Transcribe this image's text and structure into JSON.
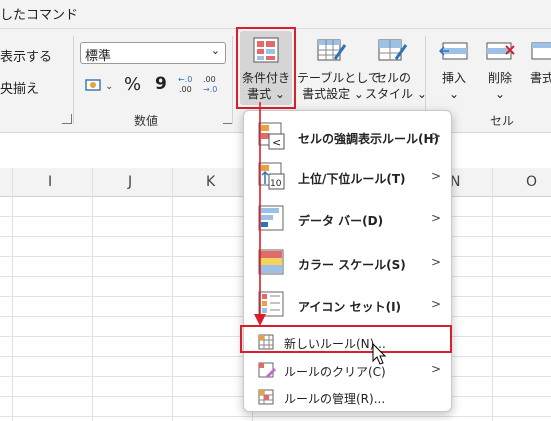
{
  "ribbon": {
    "title_fragment": "したコマンド",
    "left_top": "表示する",
    "left_mid": "央揃え",
    "number_format": {
      "value": "標準"
    },
    "number_group_label": "数値",
    "cells_group_label": "セル",
    "buttons": {
      "conditional": {
        "line1": "条件付き",
        "line2": "書式 ⌄"
      },
      "table": {
        "line1": "テーブルとして",
        "line2": "書式設定 ⌄"
      },
      "cell_style": {
        "line1": "セルの",
        "line2": "スタイル ⌄"
      },
      "insert": {
        "line1": "挿入",
        "line2": "⌄"
      },
      "delete": {
        "line1": "削除",
        "line2": "⌄"
      },
      "format": {
        "line1": "書式"
      }
    },
    "number_buttons": {
      "percent": "%",
      "comma": "9",
      "inc": "←.0\n.00",
      "dec": ".00\n→.0"
    }
  },
  "sheet": {
    "columns": [
      "I",
      "J",
      "K",
      "N",
      "O"
    ]
  },
  "menu": {
    "items": [
      {
        "label": "セルの強調表示ルール(H)"
      },
      {
        "label": "上位/下位ルール(T)"
      },
      {
        "label": "データ バー(D)"
      },
      {
        "label": "カラー スケール(S)"
      },
      {
        "label": "アイコン セット(I)"
      },
      {
        "label": "新しいルール(N)..."
      },
      {
        "label": "ルールのクリア(C)"
      },
      {
        "label": "ルールの管理(R)..."
      }
    ]
  },
  "colors": {
    "highlight_red": "#d8202a",
    "accent_blue": "#2e74b5"
  }
}
